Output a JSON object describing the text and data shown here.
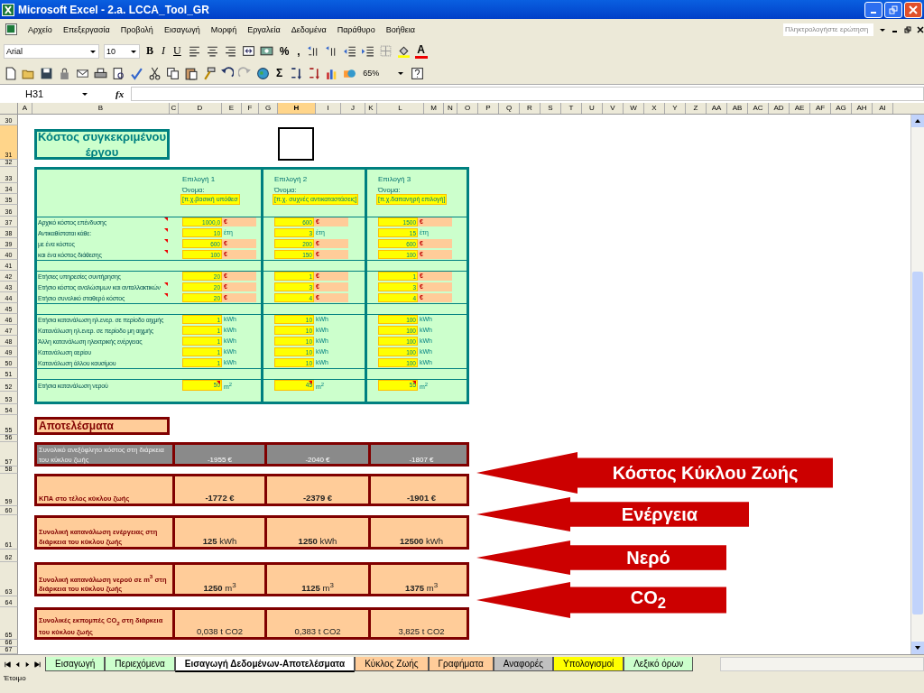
{
  "window": {
    "title": "Microsoft Excel - 2.a. LCCA_Tool_GR"
  },
  "menu": [
    "Αρχείο",
    "Επεξεργασία",
    "Προβολή",
    "Εισαγωγή",
    "Μορφή",
    "Εργαλεία",
    "Δεδομένα",
    "Παράθυρο",
    "Βοήθεια"
  ],
  "help_search": {
    "placeholder": "Πληκτρολογήστε ερώτηση"
  },
  "format_toolbar": {
    "font": "Arial",
    "size": "10",
    "style_buttons": [
      "B",
      "I",
      "U"
    ],
    "percent": "%",
    "comma": ",",
    "font_color_letter": "A"
  },
  "standard_toolbar": {
    "sum": "Σ",
    "zoom": "65%"
  },
  "formula_bar": {
    "name_box": "H31",
    "function_label": "fx"
  },
  "column_headers": [
    {
      "label": "A",
      "selected": false
    },
    {
      "label": "B",
      "selected": false
    },
    {
      "label": "C",
      "selected": false
    },
    {
      "label": "D",
      "selected": false
    },
    {
      "label": "E",
      "selected": false
    },
    {
      "label": "F",
      "selected": false
    },
    {
      "label": "G",
      "selected": false
    },
    {
      "label": "H",
      "selected": true
    },
    {
      "label": "I",
      "selected": false
    },
    {
      "label": "J",
      "selected": false
    },
    {
      "label": "K",
      "selected": false
    },
    {
      "label": "L",
      "selected": false
    },
    {
      "label": "M",
      "selected": false
    },
    {
      "label": "N",
      "selected": false
    },
    {
      "label": "O",
      "selected": false
    },
    {
      "label": "P",
      "selected": false
    },
    {
      "label": "Q",
      "selected": false
    },
    {
      "label": "R",
      "selected": false
    },
    {
      "label": "S",
      "selected": false
    },
    {
      "label": "T",
      "selected": false
    },
    {
      "label": "U",
      "selected": false
    },
    {
      "label": "V",
      "selected": false
    },
    {
      "label": "W",
      "selected": false
    },
    {
      "label": "X",
      "selected": false
    },
    {
      "label": "Y",
      "selected": false
    },
    {
      "label": "Z",
      "selected": false
    },
    {
      "label": "AA",
      "selected": false
    },
    {
      "label": "AB",
      "selected": false
    },
    {
      "label": "AC",
      "selected": false
    },
    {
      "label": "AD",
      "selected": false
    },
    {
      "label": "AE",
      "selected": false
    },
    {
      "label": "AF",
      "selected": false
    },
    {
      "label": "AG",
      "selected": false
    },
    {
      "label": "AH",
      "selected": false
    },
    {
      "label": "AI",
      "selected": false
    }
  ],
  "row_numbers": [
    {
      "label": "30",
      "selected": false
    },
    {
      "label": "31",
      "selected": true
    },
    {
      "label": "32",
      "selected": false
    },
    {
      "label": "33",
      "selected": false
    },
    {
      "label": "34",
      "selected": false
    },
    {
      "label": "35",
      "selected": false
    },
    {
      "label": "36",
      "selected": false
    },
    {
      "label": "37",
      "selected": false
    },
    {
      "label": "38",
      "selected": false
    },
    {
      "label": "39",
      "selected": false
    },
    {
      "label": "40",
      "selected": false
    },
    {
      "label": "41",
      "selected": false
    },
    {
      "label": "42",
      "selected": false
    },
    {
      "label": "43",
      "selected": false
    },
    {
      "label": "44",
      "selected": false
    },
    {
      "label": "45",
      "selected": false
    },
    {
      "label": "46",
      "selected": false
    },
    {
      "label": "47",
      "selected": false
    },
    {
      "label": "48",
      "selected": false
    },
    {
      "label": "49",
      "selected": false
    },
    {
      "label": "50",
      "selected": false
    },
    {
      "label": "51",
      "selected": false
    },
    {
      "label": "52",
      "selected": false
    },
    {
      "label": "53",
      "selected": false
    },
    {
      "label": "54",
      "selected": false
    },
    {
      "label": "55",
      "selected": false
    },
    {
      "label": "56",
      "selected": false
    },
    {
      "label": "57",
      "selected": false
    },
    {
      "label": "58",
      "selected": false
    },
    {
      "label": "59",
      "selected": false
    },
    {
      "label": "60",
      "selected": false
    },
    {
      "label": "61",
      "selected": false
    },
    {
      "label": "62",
      "selected": false
    },
    {
      "label": "63",
      "selected": false
    },
    {
      "label": "64",
      "selected": false
    },
    {
      "label": "65",
      "selected": false
    },
    {
      "label": "66",
      "selected": false
    },
    {
      "label": "67",
      "selected": false
    }
  ],
  "project_title": "Κόστος συγκεκριμένου έργου",
  "inputs": {
    "options": [
      {
        "heading": "Επιλογή 1",
        "name_label": "Όνομα:",
        "name_value": "[π.χ.βασική υπόθεσ"
      },
      {
        "heading": "Επιλογή 2",
        "name_label": "Όνομα:",
        "name_value": "[π.χ. συχνές αντικαταστάσεις]"
      },
      {
        "heading": "Επιλογή 3",
        "name_label": "Όνομα:",
        "name_value": "[π.χ.δαπανηρή επιλογή]"
      }
    ],
    "groups": [
      {
        "rows": [
          {
            "label": "Αρχικό κόστος επένδυσης",
            "comment": true,
            "kind": "money",
            "values": [
              "1000,0",
              "600",
              "1500"
            ],
            "units": [
              "€",
              "€",
              "€"
            ]
          },
          {
            "label": "Αντικαθίσταται κάθε:",
            "comment": true,
            "kind": "plain",
            "values": [
              "10",
              "3",
              "15"
            ],
            "units": [
              "έτη",
              "έτη",
              "έτη"
            ]
          },
          {
            "label": "με ένα κόστος",
            "comment": true,
            "kind": "money",
            "values": [
              "600",
              "200",
              "600"
            ],
            "units": [
              "€",
              "€",
              "€"
            ]
          },
          {
            "label": "και ένα κόστος διάθεσης",
            "comment": true,
            "kind": "money",
            "values": [
              "100",
              "150",
              "100"
            ],
            "units": [
              "€",
              "€",
              "€"
            ]
          }
        ]
      },
      {
        "rows": [
          {
            "label": "Ετήσιες υπηρεσίες συντήρησης",
            "kind": "money",
            "values": [
              "20",
              "1",
              "1"
            ],
            "units": [
              "€",
              "€",
              "€"
            ]
          },
          {
            "label": "Ετήσιο κόστος αναλώσιμων και ανταλλακτικών",
            "comment": true,
            "kind": "money",
            "values": [
              "20",
              "3",
              "3"
            ],
            "units": [
              "€",
              "€",
              "€"
            ]
          },
          {
            "label": "Ετήσιο συνολικό σταθερό κόστος",
            "comment": true,
            "kind": "money",
            "values": [
              "20",
              "4",
              "4"
            ],
            "units": [
              "€",
              "€",
              "€"
            ]
          }
        ]
      },
      {
        "rows": [
          {
            "label": "Ετήσια κατανάλωση ηλ.ενερ. σε περίοδο αιχμής",
            "kind": "plain",
            "values": [
              "1",
              "10",
              "100"
            ],
            "units": [
              "kWh",
              "kWh",
              "kWh"
            ]
          },
          {
            "label": "Κατανάλωση ηλ.ενερ. σε περίοδο μη αιχμής",
            "kind": "plain",
            "values": [
              "1",
              "10",
              "100"
            ],
            "units": [
              "kWh",
              "kWh",
              "kWh"
            ]
          },
          {
            "label": "Άλλη κατανάλωση ηλεκτρικής ενέργειας",
            "kind": "plain",
            "values": [
              "1",
              "10",
              "100"
            ],
            "units": [
              "kWh",
              "kWh",
              "kWh"
            ]
          },
          {
            "label": "Κατανάλωση αερίου",
            "kind": "plain",
            "values": [
              "1",
              "10",
              "100"
            ],
            "units": [
              "kWh",
              "kWh",
              "kWh"
            ]
          },
          {
            "label": "Κατανάλωση άλλου καυσίμου",
            "kind": "plain",
            "values": [
              "1",
              "10",
              "100"
            ],
            "units": [
              "kWh",
              "kWh",
              "kWh"
            ]
          }
        ]
      },
      {
        "rows": [
          {
            "label": "Ετήσια κατανάλωση νερού",
            "kind": "plain",
            "values": [
              "50",
              "45",
              "55"
            ],
            "units": [
              "m$^{2}$",
              "m$^{2}$",
              "m$^{2}$"
            ],
            "values_commented": true
          }
        ]
      }
    ]
  },
  "results": {
    "title": "Αποτελέσματα",
    "rows": [
      {
        "kind": "summary",
        "label": "Συνολικό ανεξόφλητο κόστος στη διάρκεια του κύκλου ζωής",
        "values": [
          "-1955 €",
          "-2040 €",
          "-1807 €"
        ]
      },
      {
        "kind": "result",
        "label": "ΚΠΑ στο τέλος κύκλου ζωής",
        "values": [
          "**-1772 €**",
          "**-2379 €**",
          "**-1901 €**"
        ]
      },
      {
        "kind": "result",
        "label": "Συνολική κατανάλωση ενέργειας στη διάρκεια του κύκλου ζωής",
        "values": [
          "**125** kWh",
          "**1250** kWh",
          "**12500** kWh"
        ]
      },
      {
        "kind": "result",
        "label": "Συνολική κατανάλωση νερού σε m$^{3}$ στη διάρκεια του κύκλου ζωής",
        "values": [
          "**1250** m$^{3}$",
          "**1125** m$^{3}$",
          "**1375** m$^{3}$"
        ]
      },
      {
        "kind": "result",
        "label": "Συνολικές εκπομπές CO$_{2}$ στη διάρκεια του κύκλου ζωής",
        "values": [
          "0,038 t CO2",
          "0,383 t CO2",
          "3,825 t CO2"
        ]
      }
    ]
  },
  "callouts": [
    {
      "text": "Κόστος Κύκλου Ζωής"
    },
    {
      "text": "Ενέργεια"
    },
    {
      "text": "Νερό"
    },
    {
      "text": "CO$_{2}$"
    }
  ],
  "sheet_tabs": [
    {
      "label": "Εισαγωγή",
      "color": "#ccffcc",
      "selected": false
    },
    {
      "label": "Περιεχόμενα",
      "color": "#ccffcc",
      "selected": false
    },
    {
      "label": "Εισαγωγή Δεδομένων-Αποτελέσματα",
      "color": "#ffffff",
      "selected": true
    },
    {
      "label": "Κύκλος Ζωής",
      "color": "#ffcc99",
      "selected": false
    },
    {
      "label": "Γραφήματα",
      "color": "#ffcc99",
      "selected": false
    },
    {
      "label": "Αναφορές",
      "color": "#c0c0c0",
      "selected": false
    },
    {
      "label": "Υπολογισμοί",
      "color": "#ffff00",
      "selected": false
    },
    {
      "label": "Λεξικό όρων",
      "color": "#ccffcc",
      "selected": false
    }
  ],
  "status_bar": {
    "text": "Έτοιμο"
  }
}
